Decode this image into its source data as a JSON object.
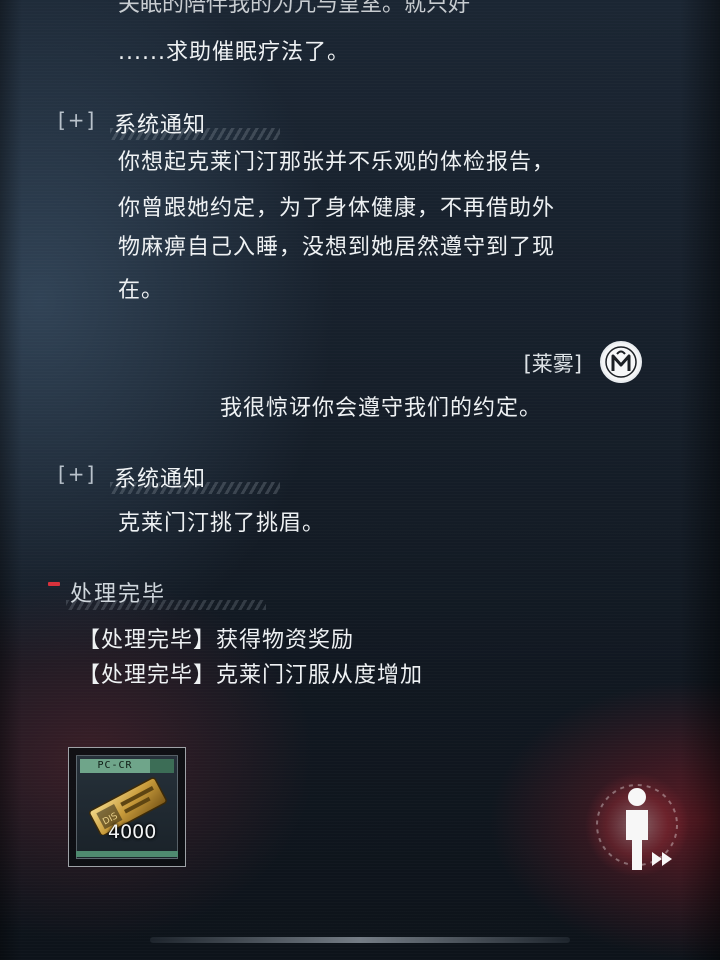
{
  "dialogue": {
    "partial_top": "关眠的陪伴我的为亢与皇室。就只好",
    "line0": "......求助催眠疗法了。",
    "notice1": {
      "bracket": "[+]",
      "label": "系统通知",
      "lines": [
        "你想起克莱门汀那张并不乐观的体检报告，",
        "你曾跟她约定，为了身体健康，不再借助外",
        "物麻痹自己入睡，没想到她居然遵守到了现",
        "在。"
      ]
    },
    "speech": {
      "speaker": "[莱雾]",
      "avatar_icon": "m-emblem-icon",
      "text": "我很惊讶你会遵守我们的约定。"
    },
    "notice2": {
      "bracket": "[+]",
      "label": "系统通知",
      "text": "克莱门汀挑了挑眉。"
    }
  },
  "result": {
    "header": "处理完毕",
    "items": [
      "【处理完毕】获得物资奖励",
      "【处理完毕】克莱门汀服从度增加"
    ]
  },
  "reward": {
    "tag": "PC-CR",
    "quantity": "4000",
    "icon": "gold-ticket-icon"
  },
  "controls": {
    "auto_icon": "auto-play-icon"
  },
  "colors": {
    "accent_red": "#d8323c",
    "reward_green": "#6fa58a"
  }
}
